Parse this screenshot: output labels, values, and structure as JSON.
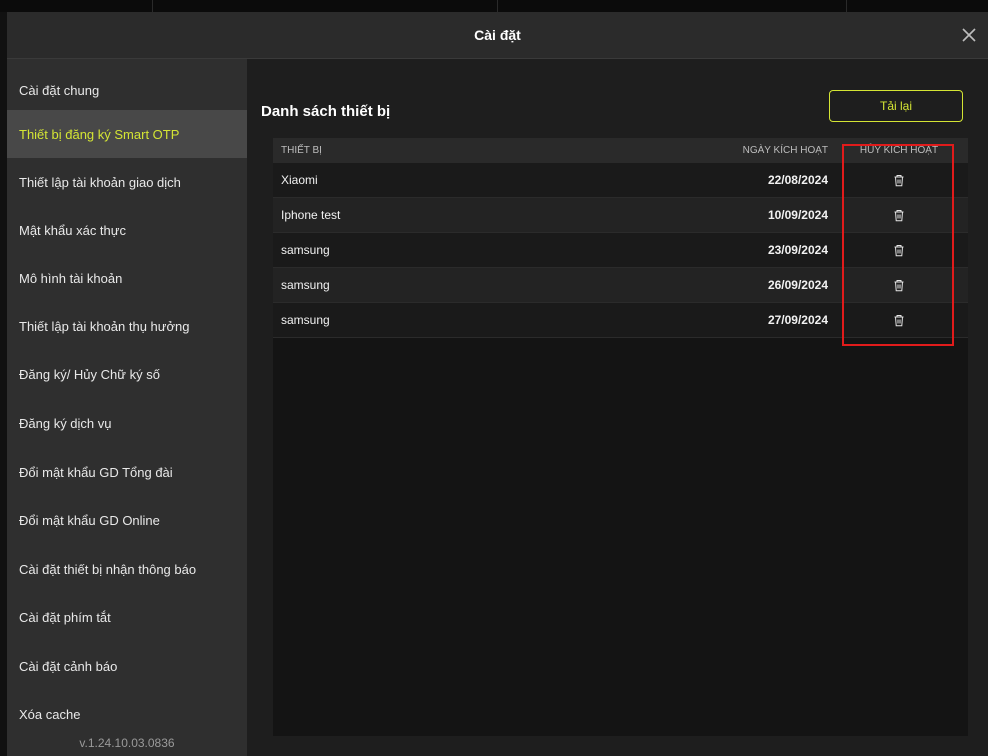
{
  "window": {
    "title": "Cài đặt"
  },
  "sidebar": {
    "items": [
      {
        "label": "Cài đặt chung"
      },
      {
        "label": "Thiết bị đăng ký Smart OTP"
      },
      {
        "label": "Thiết lập tài khoản giao dịch"
      },
      {
        "label": "Mật khẩu xác thực"
      },
      {
        "label": "Mô hình tài khoản"
      },
      {
        "label": "Thiết lập tài khoản thụ hưởng"
      },
      {
        "label": "Đăng ký/ Hủy Chữ ký số"
      },
      {
        "label": "Đăng ký dịch vụ"
      },
      {
        "label": "Đổi mật khẩu GD Tổng đài"
      },
      {
        "label": "Đổi mật khẩu GD Online"
      },
      {
        "label": "Cài đặt thiết bị nhận thông báo"
      },
      {
        "label": "Cài đặt phím tắt"
      },
      {
        "label": "Cài đặt cảnh báo"
      },
      {
        "label": "Xóa cache"
      }
    ],
    "active_index": 1,
    "version": "v.1.24.10.03.0836"
  },
  "main": {
    "section_title": "Danh sách thiết bị",
    "reload_label": "Tải lại",
    "table": {
      "columns": [
        "THIẾT BỊ",
        "NGÀY KÍCH HOẠT",
        "HỦY KÍCH HOẠT"
      ],
      "rows": [
        {
          "device": "Xiaomi",
          "date": "22/08/2024"
        },
        {
          "device": "Iphone test",
          "date": "10/09/2024"
        },
        {
          "device": "samsung",
          "date": "23/09/2024"
        },
        {
          "device": "samsung",
          "date": "26/09/2024"
        },
        {
          "device": "samsung",
          "date": "27/09/2024"
        }
      ],
      "row_action_icon": "trash-icon"
    }
  },
  "colors": {
    "accent": "#d4e534",
    "highlight": "#e11b1b",
    "sidebar_bg": "#2f2f2f",
    "active_item_bg": "#484848"
  }
}
